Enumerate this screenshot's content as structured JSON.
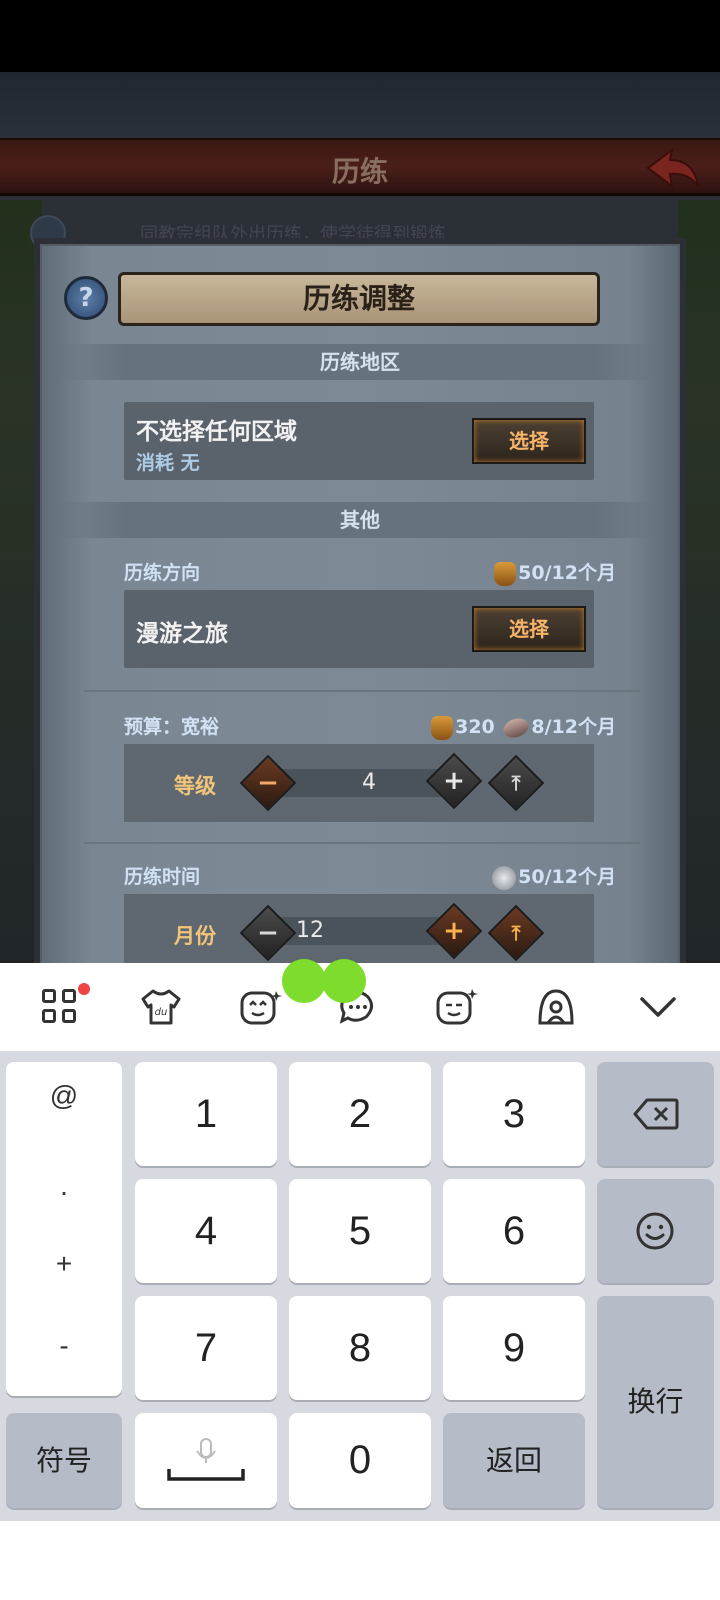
{
  "game": {
    "title": "历练",
    "background_hint": "同教宗组队外出历练，使学徒得到锻炼",
    "dialog": {
      "title": "历练调整",
      "help_label": "?",
      "region_section": "历练地区",
      "region_name": "不选择任何区域",
      "region_cost": "消耗 无",
      "region_button": "选择",
      "other_section": "其他",
      "direction_label": "历练方向",
      "direction_cost": "50/12个月",
      "direction_name": "漫游之旅",
      "direction_button": "选择",
      "budget_label": "预算：宽裕",
      "budget_cost_bag": "320",
      "budget_cost_fish": "8/12个月",
      "level_label": "等级",
      "level_value": "4",
      "time_label": "历练时间",
      "time_cost": "50/12个月",
      "month_label": "月份",
      "month_value": "12"
    }
  },
  "keyboard": {
    "toolbar_icons": [
      "apps-grid-icon",
      "skin-shirt-icon",
      "emoji-face-icon",
      "chat-bubble-icon",
      "sticker-icon",
      "voice-assistant-icon",
      "collapse-chevron-icon"
    ],
    "side_symbols": [
      "@",
      ".",
      "+",
      "-"
    ],
    "digits": [
      "1",
      "2",
      "3",
      "4",
      "5",
      "6",
      "7",
      "8",
      "9",
      "0"
    ],
    "symbols_key": "符号",
    "return_key": "返回",
    "newline_key": "换行"
  }
}
